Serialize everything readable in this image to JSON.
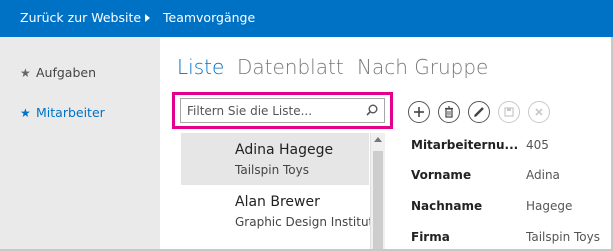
{
  "topbar": {
    "back_label": "Zurück zur Website",
    "crumb": "Teamvorgänge"
  },
  "sidebar": {
    "items": [
      {
        "label": "Aufgaben",
        "icon": "star-icon",
        "active": false
      },
      {
        "label": "Mitarbeiter",
        "icon": "star-icon",
        "active": true
      }
    ]
  },
  "views": {
    "tabs": [
      {
        "label": "Liste",
        "active": true
      },
      {
        "label": "Datenblatt",
        "active": false
      },
      {
        "label": "Nach Gruppe",
        "active": false
      }
    ]
  },
  "search": {
    "placeholder": "Filtern Sie die Liste..."
  },
  "list": {
    "items": [
      {
        "name": "Adina Hagege",
        "company": "Tailspin Toys",
        "selected": true
      },
      {
        "name": "Alan Brewer",
        "company": "Graphic Design Institut",
        "selected": false
      }
    ]
  },
  "actions": [
    {
      "icon": "add-icon",
      "enabled": true
    },
    {
      "icon": "delete-icon",
      "enabled": true
    },
    {
      "icon": "edit-icon",
      "enabled": true
    },
    {
      "icon": "save-icon",
      "enabled": false
    },
    {
      "icon": "cancel-icon",
      "enabled": false
    }
  ],
  "details": {
    "fields": [
      {
        "label": "Mitarbeiternu...",
        "value": "405"
      },
      {
        "label": "Vorname",
        "value": "Adina"
      },
      {
        "label": "Nachname",
        "value": "Hagege"
      },
      {
        "label": "Firma",
        "value": "Tailspin Toys"
      }
    ]
  },
  "colors": {
    "accent": "#0072c6",
    "highlight": "#e3008c",
    "nav_bg": "#eaeaea"
  }
}
